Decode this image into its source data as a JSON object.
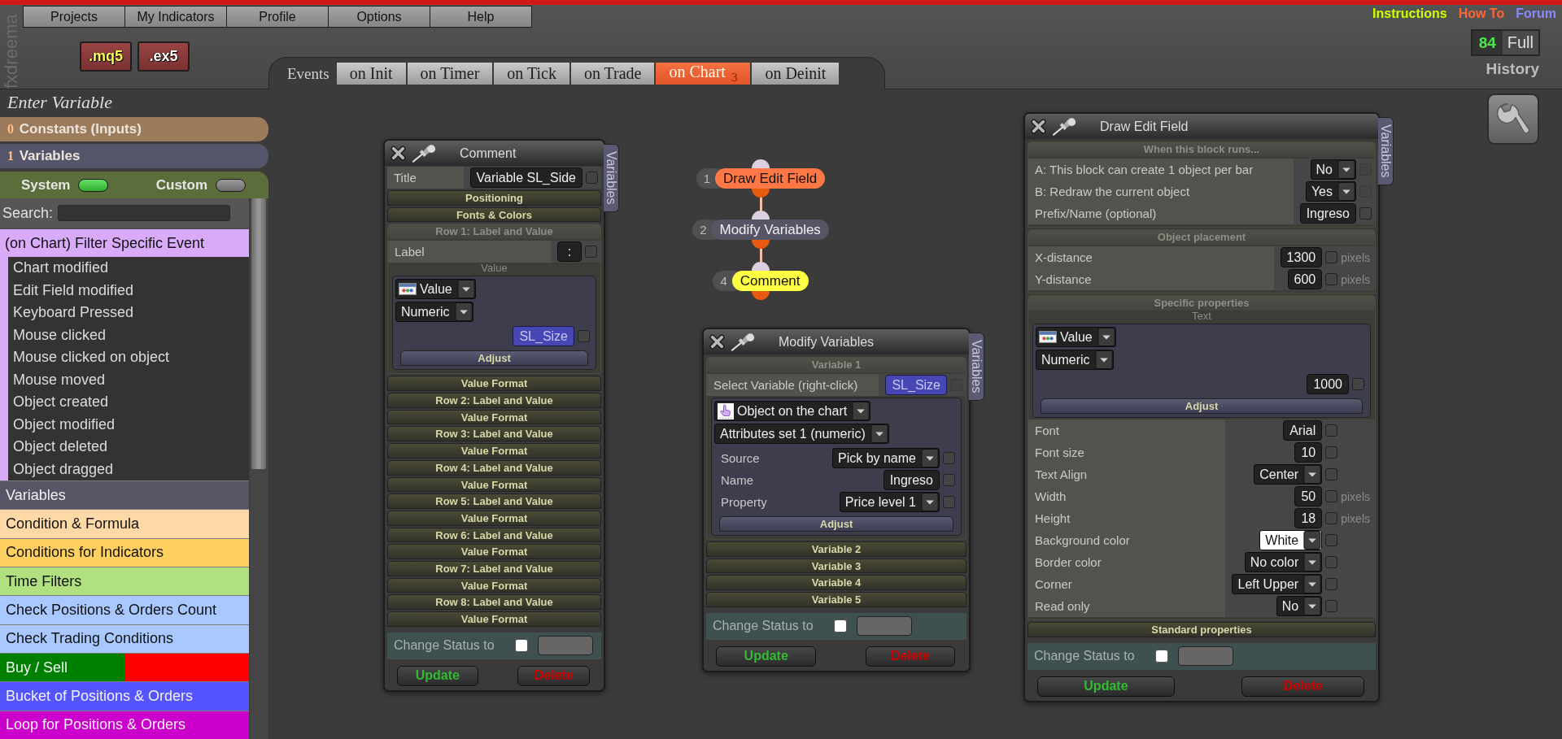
{
  "logo": "fxdreema",
  "menu": [
    {
      "label": "Projects"
    },
    {
      "label": "My Indicators"
    },
    {
      "label": "Profile"
    },
    {
      "label": "Options"
    },
    {
      "label": "Help"
    }
  ],
  "export_buttons": [
    {
      "label": ".mq5",
      "kind": "source"
    },
    {
      "label": ".ex5",
      "kind": "compiled"
    }
  ],
  "top_links": [
    {
      "label": "Instructions",
      "color": "#ccff00"
    },
    {
      "label": "How To",
      "color": "#ff6633"
    },
    {
      "label": "Forum",
      "color": "#8888ff"
    }
  ],
  "history": {
    "count": "84",
    "mode": "Full",
    "label": "History"
  },
  "events": {
    "label": "Events",
    "tabs": [
      {
        "label": "on Init",
        "selected": false
      },
      {
        "label": "on Timer",
        "selected": false
      },
      {
        "label": "on Tick",
        "selected": false
      },
      {
        "label": "on Trade",
        "selected": false
      },
      {
        "label": "on Chart",
        "count": "3",
        "selected": true
      },
      {
        "label": "on Deinit",
        "selected": false
      }
    ]
  },
  "sidebar": {
    "title": "Enter Variable",
    "sections": [
      {
        "number": "0",
        "label": "Constants (Inputs)",
        "color": "#9c7a5c"
      },
      {
        "number": "1",
        "label": "Variables",
        "color": "#55556a"
      }
    ],
    "toggles": [
      {
        "label": "System",
        "on": true
      },
      {
        "label": "Custom",
        "on": false
      }
    ],
    "search": {
      "label": "Search:"
    },
    "group": {
      "label": "(on Chart) Filter Specific Event",
      "items": [
        "Chart modified",
        "Edit Field modified",
        "Keyboard Pressed",
        "Mouse clicked",
        "Mouse clicked on object",
        "Mouse moved",
        "Object created",
        "Object modified",
        "Object deleted",
        "Object dragged"
      ]
    },
    "categories": [
      {
        "label": "Variables",
        "color": "#555566"
      },
      {
        "label": "Condition & Formula",
        "color": "#ffd8a8"
      },
      {
        "label": "Conditions for Indicators",
        "color": "#ffd060"
      },
      {
        "label": "Time Filters",
        "color": "#b0e080"
      },
      {
        "label": "Check Positions & Orders Count",
        "color": "#a8c8ff"
      },
      {
        "label": "Check Trading Conditions",
        "color": "#a8c8ff"
      },
      {
        "label": "Buy / Sell",
        "segments": [
          {
            "color": "#008000"
          },
          {
            "color": "#ff0000"
          }
        ]
      },
      {
        "label": "Bucket of Positions & Orders",
        "color": "#5555ff"
      },
      {
        "label": "Loop for Positions & Orders",
        "color": "#cc00cc"
      }
    ]
  },
  "flow": [
    {
      "number": "1",
      "label": "Draw Edit Field",
      "color": "#ff7744"
    },
    {
      "number": "2",
      "label": "Modify Variables",
      "color": "#555566"
    },
    {
      "number": "4",
      "label": "Comment",
      "color": "#ffff44"
    }
  ],
  "blocks": [
    {
      "title": "Comment",
      "side_tab": "Variables",
      "items": [
        {
          "kind": "field",
          "label": "Title",
          "value": "Variable SL_Side",
          "checked": false
        },
        {
          "kind": "section",
          "label": "Positioning",
          "expanded": false
        },
        {
          "kind": "section",
          "label": "Fonts & Colors",
          "expanded": false
        },
        {
          "kind": "section",
          "label": "Row 1: Label and Value",
          "expanded": true,
          "items": [
            {
              "kind": "field",
              "label": "Label",
              "value": ":",
              "checked": false
            },
            {
              "kind": "caption",
              "label": "Value"
            },
            {
              "kind": "panel",
              "items": [
                {
                  "kind": "value_source",
                  "label": "Value"
                },
                {
                  "kind": "dropdown",
                  "label": "Numeric"
                },
                {
                  "kind": "variable",
                  "value": "SL_Size",
                  "checked": false
                },
                {
                  "kind": "adjust",
                  "label": "Adjust"
                }
              ]
            }
          ]
        },
        {
          "kind": "section",
          "label": "Value Format",
          "expanded": false
        },
        {
          "kind": "section",
          "label": "Row 2: Label and Value",
          "expanded": false
        },
        {
          "kind": "section",
          "label": "Value Format",
          "expanded": false
        },
        {
          "kind": "section",
          "label": "Row 3: Label and Value",
          "expanded": false
        },
        {
          "kind": "section",
          "label": "Value Format",
          "expanded": false
        },
        {
          "kind": "section",
          "label": "Row 4: Label and Value",
          "expanded": false
        },
        {
          "kind": "section",
          "label": "Value Format",
          "expanded": false
        },
        {
          "kind": "section",
          "label": "Row 5: Label and Value",
          "expanded": false
        },
        {
          "kind": "section",
          "label": "Value Format",
          "expanded": false
        },
        {
          "kind": "section",
          "label": "Row 6: Label and Value",
          "expanded": false
        },
        {
          "kind": "section",
          "label": "Value Format",
          "expanded": false
        },
        {
          "kind": "section",
          "label": "Row 7: Label and Value",
          "expanded": false
        },
        {
          "kind": "section",
          "label": "Value Format",
          "expanded": false
        },
        {
          "kind": "section",
          "label": "Row 8: Label and Value",
          "expanded": false
        },
        {
          "kind": "section",
          "label": "Value Format",
          "expanded": false
        }
      ],
      "status": {
        "label": "Change Status to",
        "checked": false
      },
      "buttons": [
        {
          "label": "Update",
          "kind": "update"
        },
        {
          "label": "Delete",
          "kind": "delete"
        }
      ]
    },
    {
      "title": "Modify Variables",
      "side_tab": "Variables",
      "items": [
        {
          "kind": "section",
          "label": "Variable 1",
          "expanded": true,
          "items": [
            {
              "kind": "variable",
              "label": "Select Variable (right-click)",
              "value": "SL_Size",
              "checked": false,
              "check_disabled": true
            },
            {
              "kind": "panel",
              "items": [
                {
                  "kind": "object_source",
                  "label": "Object on the chart"
                },
                {
                  "kind": "dropdown",
                  "label": "Attributes set 1 (numeric)"
                },
                {
                  "kind": "select",
                  "label": "Source",
                  "value": "Pick by name",
                  "checked": false
                },
                {
                  "kind": "field",
                  "label": "Name",
                  "value": "Ingreso",
                  "checked": false
                },
                {
                  "kind": "select",
                  "label": "Property",
                  "value": "Price level 1",
                  "checked": false
                },
                {
                  "kind": "adjust",
                  "label": "Adjust"
                }
              ]
            }
          ]
        },
        {
          "kind": "section",
          "label": "Variable 2",
          "expanded": false
        },
        {
          "kind": "section",
          "label": "Variable 3",
          "expanded": false
        },
        {
          "kind": "section",
          "label": "Variable 4",
          "expanded": false
        },
        {
          "kind": "section",
          "label": "Variable 5",
          "expanded": false
        }
      ],
      "status": {
        "label": "Change Status to",
        "checked": false
      },
      "buttons": [
        {
          "label": "Update",
          "kind": "update"
        },
        {
          "label": "Delete",
          "kind": "delete"
        }
      ]
    },
    {
      "title": "Draw Edit Field",
      "side_tab": "Variables",
      "items": [
        {
          "kind": "section",
          "label": "When this block runs...",
          "expanded": true,
          "items": [
            {
              "kind": "select",
              "label": "A: This block can create 1 object per bar",
              "value": "No",
              "checked": false,
              "check_disabled": true
            },
            {
              "kind": "select",
              "label": "B: Redraw the current object",
              "value": "Yes",
              "checked": false,
              "check_disabled": true
            },
            {
              "kind": "field",
              "label": "Prefix/Name (optional)",
              "value": "Ingreso",
              "checked": false
            }
          ]
        },
        {
          "kind": "section",
          "label": "Object placement",
          "expanded": true,
          "items": [
            {
              "kind": "field",
              "label": "X-distance",
              "value": "1300",
              "checked": false,
              "unit": "pixels"
            },
            {
              "kind": "field",
              "label": "Y-distance",
              "value": "600",
              "checked": false,
              "unit": "pixels"
            }
          ]
        },
        {
          "kind": "section",
          "label": "Specific properties",
          "expanded": true,
          "items": [
            {
              "kind": "caption",
              "label": "Text"
            },
            {
              "kind": "panel",
              "items": [
                {
                  "kind": "value_source",
                  "label": "Value"
                },
                {
                  "kind": "dropdown",
                  "label": "Numeric"
                },
                {
                  "kind": "field",
                  "value": "1000",
                  "checked": false
                },
                {
                  "kind": "adjust",
                  "label": "Adjust"
                }
              ]
            },
            {
              "kind": "field",
              "label": "Font",
              "value": "Arial",
              "checked": false
            },
            {
              "kind": "field",
              "label": "Font size",
              "value": "10",
              "checked": false
            },
            {
              "kind": "select",
              "label": "Text Align",
              "value": "Center",
              "checked": false
            },
            {
              "kind": "field",
              "label": "Width",
              "value": "50",
              "checked": false,
              "unit": "pixels"
            },
            {
              "kind": "field",
              "label": "Height",
              "value": "18",
              "checked": false,
              "unit": "pixels"
            },
            {
              "kind": "select",
              "label": "Background color",
              "value": "White",
              "checked": false,
              "color": "#ffffff"
            },
            {
              "kind": "select",
              "label": "Border color",
              "value": "No color",
              "checked": false
            },
            {
              "kind": "select",
              "label": "Corner",
              "value": "Left Upper",
              "checked": false
            },
            {
              "kind": "select",
              "label": "Read only",
              "value": "No",
              "checked": false
            }
          ]
        },
        {
          "kind": "section",
          "label": "Standard properties",
          "expanded": false
        }
      ],
      "status": {
        "label": "Change Status to",
        "checked": false
      },
      "buttons": [
        {
          "label": "Update",
          "kind": "update"
        },
        {
          "label": "Delete",
          "kind": "delete"
        }
      ]
    }
  ]
}
